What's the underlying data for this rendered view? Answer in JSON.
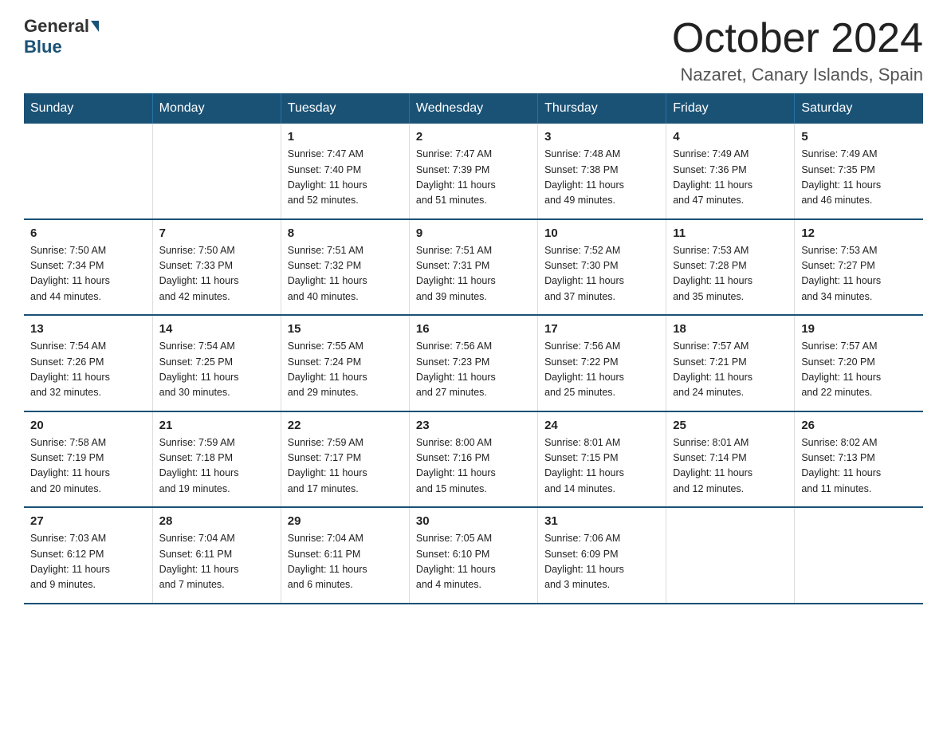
{
  "logo": {
    "general": "General",
    "blue": "Blue"
  },
  "header": {
    "month": "October 2024",
    "location": "Nazaret, Canary Islands, Spain"
  },
  "weekdays": [
    "Sunday",
    "Monday",
    "Tuesday",
    "Wednesday",
    "Thursday",
    "Friday",
    "Saturday"
  ],
  "weeks": [
    [
      {
        "day": "",
        "info": ""
      },
      {
        "day": "",
        "info": ""
      },
      {
        "day": "1",
        "info": "Sunrise: 7:47 AM\nSunset: 7:40 PM\nDaylight: 11 hours\nand 52 minutes."
      },
      {
        "day": "2",
        "info": "Sunrise: 7:47 AM\nSunset: 7:39 PM\nDaylight: 11 hours\nand 51 minutes."
      },
      {
        "day": "3",
        "info": "Sunrise: 7:48 AM\nSunset: 7:38 PM\nDaylight: 11 hours\nand 49 minutes."
      },
      {
        "day": "4",
        "info": "Sunrise: 7:49 AM\nSunset: 7:36 PM\nDaylight: 11 hours\nand 47 minutes."
      },
      {
        "day": "5",
        "info": "Sunrise: 7:49 AM\nSunset: 7:35 PM\nDaylight: 11 hours\nand 46 minutes."
      }
    ],
    [
      {
        "day": "6",
        "info": "Sunrise: 7:50 AM\nSunset: 7:34 PM\nDaylight: 11 hours\nand 44 minutes."
      },
      {
        "day": "7",
        "info": "Sunrise: 7:50 AM\nSunset: 7:33 PM\nDaylight: 11 hours\nand 42 minutes."
      },
      {
        "day": "8",
        "info": "Sunrise: 7:51 AM\nSunset: 7:32 PM\nDaylight: 11 hours\nand 40 minutes."
      },
      {
        "day": "9",
        "info": "Sunrise: 7:51 AM\nSunset: 7:31 PM\nDaylight: 11 hours\nand 39 minutes."
      },
      {
        "day": "10",
        "info": "Sunrise: 7:52 AM\nSunset: 7:30 PM\nDaylight: 11 hours\nand 37 minutes."
      },
      {
        "day": "11",
        "info": "Sunrise: 7:53 AM\nSunset: 7:28 PM\nDaylight: 11 hours\nand 35 minutes."
      },
      {
        "day": "12",
        "info": "Sunrise: 7:53 AM\nSunset: 7:27 PM\nDaylight: 11 hours\nand 34 minutes."
      }
    ],
    [
      {
        "day": "13",
        "info": "Sunrise: 7:54 AM\nSunset: 7:26 PM\nDaylight: 11 hours\nand 32 minutes."
      },
      {
        "day": "14",
        "info": "Sunrise: 7:54 AM\nSunset: 7:25 PM\nDaylight: 11 hours\nand 30 minutes."
      },
      {
        "day": "15",
        "info": "Sunrise: 7:55 AM\nSunset: 7:24 PM\nDaylight: 11 hours\nand 29 minutes."
      },
      {
        "day": "16",
        "info": "Sunrise: 7:56 AM\nSunset: 7:23 PM\nDaylight: 11 hours\nand 27 minutes."
      },
      {
        "day": "17",
        "info": "Sunrise: 7:56 AM\nSunset: 7:22 PM\nDaylight: 11 hours\nand 25 minutes."
      },
      {
        "day": "18",
        "info": "Sunrise: 7:57 AM\nSunset: 7:21 PM\nDaylight: 11 hours\nand 24 minutes."
      },
      {
        "day": "19",
        "info": "Sunrise: 7:57 AM\nSunset: 7:20 PM\nDaylight: 11 hours\nand 22 minutes."
      }
    ],
    [
      {
        "day": "20",
        "info": "Sunrise: 7:58 AM\nSunset: 7:19 PM\nDaylight: 11 hours\nand 20 minutes."
      },
      {
        "day": "21",
        "info": "Sunrise: 7:59 AM\nSunset: 7:18 PM\nDaylight: 11 hours\nand 19 minutes."
      },
      {
        "day": "22",
        "info": "Sunrise: 7:59 AM\nSunset: 7:17 PM\nDaylight: 11 hours\nand 17 minutes."
      },
      {
        "day": "23",
        "info": "Sunrise: 8:00 AM\nSunset: 7:16 PM\nDaylight: 11 hours\nand 15 minutes."
      },
      {
        "day": "24",
        "info": "Sunrise: 8:01 AM\nSunset: 7:15 PM\nDaylight: 11 hours\nand 14 minutes."
      },
      {
        "day": "25",
        "info": "Sunrise: 8:01 AM\nSunset: 7:14 PM\nDaylight: 11 hours\nand 12 minutes."
      },
      {
        "day": "26",
        "info": "Sunrise: 8:02 AM\nSunset: 7:13 PM\nDaylight: 11 hours\nand 11 minutes."
      }
    ],
    [
      {
        "day": "27",
        "info": "Sunrise: 7:03 AM\nSunset: 6:12 PM\nDaylight: 11 hours\nand 9 minutes."
      },
      {
        "day": "28",
        "info": "Sunrise: 7:04 AM\nSunset: 6:11 PM\nDaylight: 11 hours\nand 7 minutes."
      },
      {
        "day": "29",
        "info": "Sunrise: 7:04 AM\nSunset: 6:11 PM\nDaylight: 11 hours\nand 6 minutes."
      },
      {
        "day": "30",
        "info": "Sunrise: 7:05 AM\nSunset: 6:10 PM\nDaylight: 11 hours\nand 4 minutes."
      },
      {
        "day": "31",
        "info": "Sunrise: 7:06 AM\nSunset: 6:09 PM\nDaylight: 11 hours\nand 3 minutes."
      },
      {
        "day": "",
        "info": ""
      },
      {
        "day": "",
        "info": ""
      }
    ]
  ]
}
